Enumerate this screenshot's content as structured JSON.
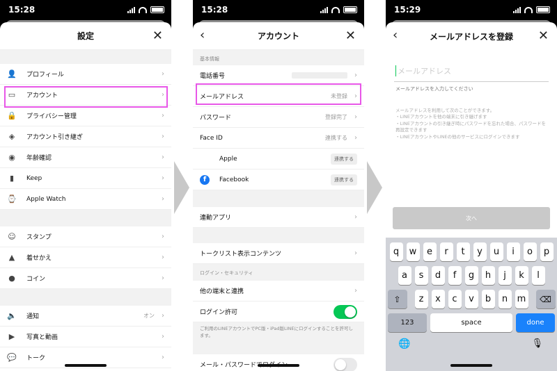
{
  "status": {
    "p1_time": "15:28",
    "p2_time": "15:28",
    "p3_time": "15:29"
  },
  "screen1": {
    "title": "設定",
    "close": "✕",
    "groups": [
      [
        {
          "label": "プロフィール",
          "icon": "person-icon",
          "glyph": "👤"
        },
        {
          "label": "アカウント",
          "icon": "id-card-icon",
          "glyph": "▭"
        },
        {
          "label": "プライバシー管理",
          "icon": "lock-icon",
          "glyph": "🔒"
        },
        {
          "label": "アカウント引き継ぎ",
          "icon": "shield-icon",
          "glyph": "◈"
        },
        {
          "label": "年齢確認",
          "icon": "age-check-icon",
          "glyph": "◉"
        },
        {
          "label": "Keep",
          "icon": "bookmark-icon",
          "glyph": "▮"
        },
        {
          "label": "Apple Watch",
          "icon": "watch-icon",
          "glyph": "⌚"
        }
      ],
      [
        {
          "label": "スタンプ",
          "icon": "smiley-icon",
          "glyph": "☺"
        },
        {
          "label": "着せかえ",
          "icon": "brush-icon",
          "glyph": "▲"
        },
        {
          "label": "コイン",
          "icon": "coin-icon",
          "glyph": "●"
        }
      ],
      [
        {
          "label": "通知",
          "icon": "speaker-icon",
          "glyph": "🔈",
          "value": "オン"
        },
        {
          "label": "写真と動画",
          "icon": "play-icon",
          "glyph": "▶"
        },
        {
          "label": "トーク",
          "icon": "chat-icon",
          "glyph": "💬"
        }
      ]
    ]
  },
  "screen2": {
    "title": "アカウント",
    "back": "‹",
    "close": "✕",
    "section_basic": "基本情報",
    "phone_label": "電話番号",
    "email_label": "メールアドレス",
    "email_value": "未登録",
    "password_label": "パスワード",
    "password_value": "登録完了",
    "faceid_label": "Face ID",
    "faceid_value": "連携する",
    "apple_label": "Apple",
    "apple_btn": "連携する",
    "facebook_label": "Facebook",
    "facebook_btn": "連携する",
    "linked_apps": "連動アプリ",
    "talklist": "トークリスト表示コンテンツ",
    "section_login": "ログイン・セキュリティ",
    "other_devices": "他の端末と連携",
    "login_allow": "ログイン許可",
    "login_note": "ご利用のLINEアカウントでPC版・iPad版LINEにログインすることを許可します。",
    "email_pw_login": "メール・パスワードでログイン",
    "toggle_on_color": "#06c755"
  },
  "screen3": {
    "title": "メールアドレスを登録",
    "back": "‹",
    "close": "✕",
    "placeholder": "メールアドレス",
    "help": "メールアドレスを入力してください",
    "info": "メールアドレスを利用して次のことができます。\n・LINEアカウントを他の端末に引き継げます\n・LINEアカウントの引き継ぎ時にパスワードを忘れた場合、パスワードを再設定できます\n・LINEアカウントやLINEの他のサービスにログインできます",
    "next": "次へ",
    "keyboard": {
      "row1": [
        "q",
        "w",
        "e",
        "r",
        "t",
        "y",
        "u",
        "i",
        "o",
        "p"
      ],
      "row2": [
        "a",
        "s",
        "d",
        "f",
        "g",
        "h",
        "j",
        "k",
        "l"
      ],
      "row3": [
        "z",
        "x",
        "c",
        "v",
        "b",
        "n",
        "m"
      ],
      "numbers": "123",
      "space": "space",
      "done": "done",
      "shift": "⇧",
      "delete": "⌫",
      "globe": "🌐",
      "mic": "🎙"
    }
  }
}
